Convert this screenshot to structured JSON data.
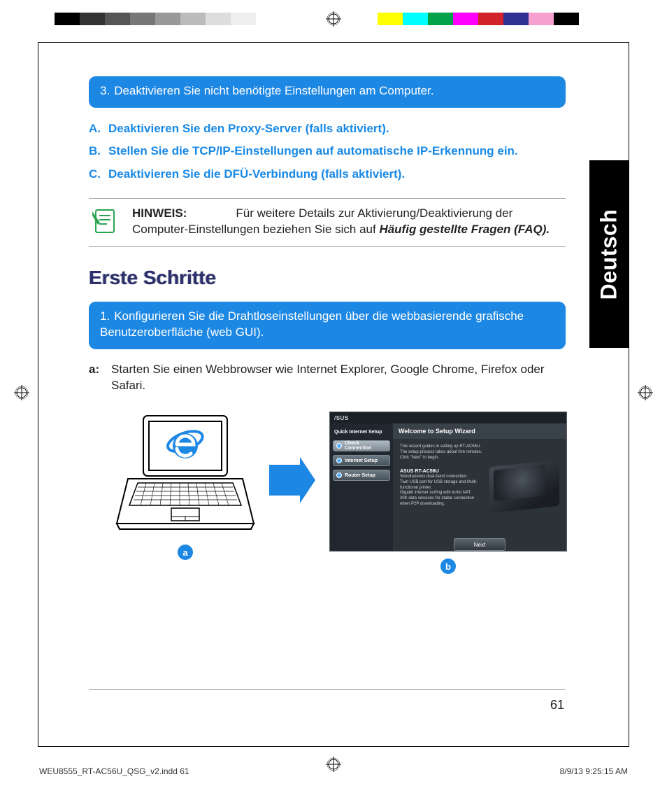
{
  "language_tab": "Deutsch",
  "page_number": "61",
  "print_footer": {
    "file": "WEU8555_RT-AC56U_QSG_v2.indd   61",
    "stamp": "8/9/13   9:25:15 AM"
  },
  "pill3": {
    "num": "3.",
    "text": "Deaktivieren Sie nicht benötigte Einstellungen am Computer."
  },
  "list": {
    "a": {
      "marker": "A.",
      "text": "Deaktivieren Sie den Proxy-Server (falls aktiviert)."
    },
    "b": {
      "marker": "B.",
      "text": "Stellen Sie die TCP/IP-Einstellungen auf automatische IP-Erkennung ein."
    },
    "c": {
      "marker": "C.",
      "text": "Deaktivieren Sie die DFÜ-Verbindung (falls aktiviert)."
    }
  },
  "hinweis": {
    "label": "HINWEIS:",
    "body_1": "Für weitere Details zur Aktivierung/Deaktivierung der Computer-Einstellungen beziehen Sie sich auf ",
    "body_2": "Häufig gestellte Fragen (FAQ)."
  },
  "heading": "Erste Schritte",
  "pill1": {
    "num": "1.",
    "text": "Konfigurieren Sie die Drahtloseinstellungen über die webbasierende grafische Benutzeroberfläche (web GUI)."
  },
  "step_a": {
    "marker": "a:",
    "text": "Starten Sie einen Webbrowser wie Internet Explorer, Google Chrome, Firefox oder Safari."
  },
  "badges": {
    "a": "a",
    "b": "b"
  },
  "wizard": {
    "brand": "/SUS",
    "side_header": "Quick Internet Setup",
    "side_items": [
      "Check Connection",
      "Internet Setup",
      "Router Setup"
    ],
    "title": "Welcome to Setup Wizard",
    "intro_1": "This wizard guides in setting up RT-AC56U.",
    "intro_2": "The setup process takes about five minutes.",
    "intro_3": "Click \"Next\" to begin.",
    "model_line": "ASUS RT-AC56U",
    "feat_1": "Simultaneous dual-band connection.",
    "feat_2": "Twin USB port for USB storage and Multi-functional printer.",
    "feat_3": "Gigabit internet surfing with turbo NAT.",
    "feat_4": "30K data sessions for stable connection when P2P downloading.",
    "next": "Next"
  }
}
